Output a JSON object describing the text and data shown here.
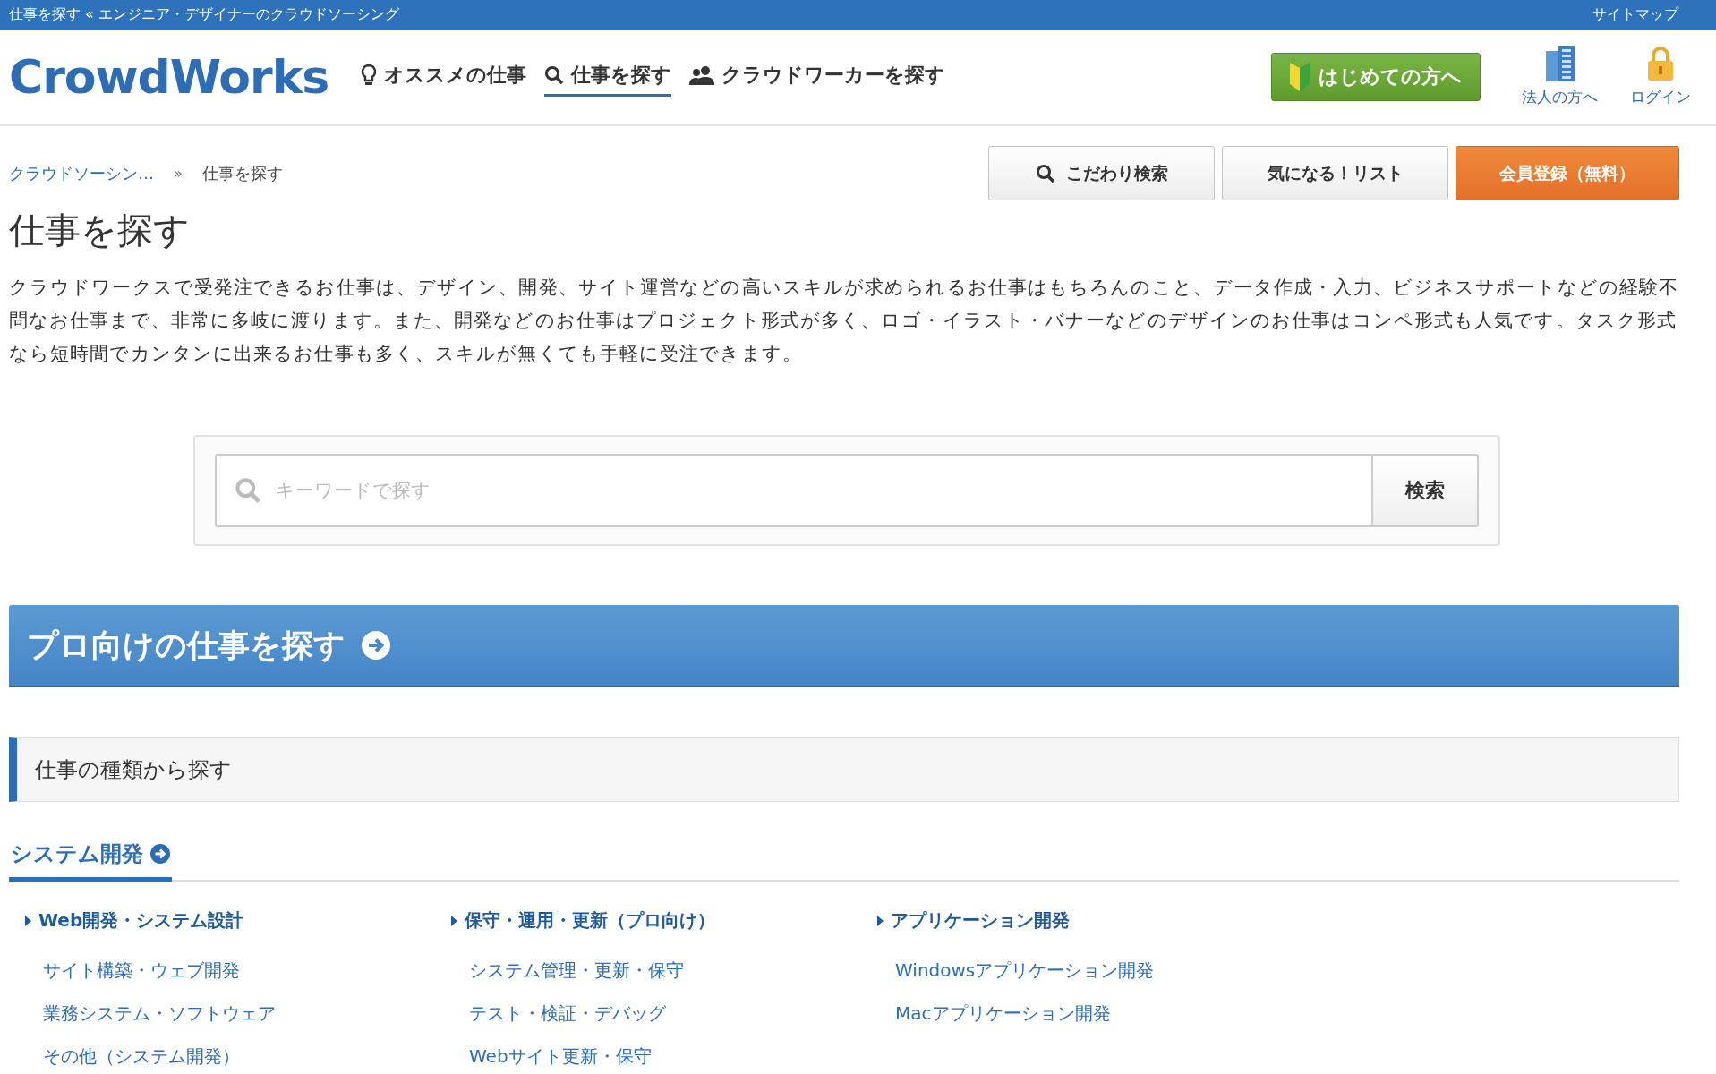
{
  "top_bar": {
    "title": "仕事を探す « エンジニア・デザイナーのクラウドソーシング",
    "sitemap": "サイトマップ"
  },
  "header": {
    "logo": "CrowdWorks",
    "nav": [
      {
        "label": "オススメの仕事",
        "kind": "bulb",
        "selected": false
      },
      {
        "label": "仕事を探す",
        "kind": "search",
        "selected": true
      },
      {
        "label": "クラウドワーカーを探す",
        "kind": "people",
        "selected": false
      }
    ],
    "beginner_button": "はじめての方へ",
    "links": [
      {
        "label": "法人の方へ",
        "kind": "building"
      },
      {
        "label": "ログイン",
        "kind": "lock"
      }
    ]
  },
  "breadcrumb": [
    {
      "label": "クラウドソーシン…",
      "kind": "link"
    },
    {
      "label": "仕事を探す",
      "kind": "current"
    }
  ],
  "breadcrumb_separator": "»",
  "actions": [
    {
      "label": "こだわり検索",
      "kind": "search"
    },
    {
      "label": "気になる！リスト",
      "kind": "plain"
    },
    {
      "label": "会員登録（無料）",
      "kind": "primary"
    }
  ],
  "page_title": "仕事を探す",
  "description": "クラウドワークスで受発注できるお仕事は、デザイン、開発、サイト運営などの高いスキルが求められるお仕事はもちろんのこと、データ作成・入力、ビジネスサポートなどの経験不問なお仕事まで、非常に多岐に渡ります。また、開発などのお仕事はプロジェクト形式が多く、ロゴ・イラスト・バナーなどのデザインのお仕事はコンペ形式も人気です。タスク形式なら短時間でカンタンに出来るお仕事も多く、スキルが無くても手軽に受注できます。",
  "search": {
    "placeholder": "キーワードで探す",
    "button": "検索"
  },
  "pro_banner": "プロ向けの仕事を探す",
  "section_title": "仕事の種類から探す",
  "category": {
    "title": "システム開発",
    "columns": [
      {
        "heading": "Web開発・システム設計",
        "links": [
          "サイト構築・ウェブ開発",
          "業務システム・ソフトウェア",
          "その他（システム開発）"
        ]
      },
      {
        "heading": "保守・運用・更新（プロ向け）",
        "links": [
          "システム管理・更新・保守",
          "テスト・検証・デバッグ",
          "Webサイト更新・保守"
        ]
      },
      {
        "heading": "アプリケーション開発",
        "links": [
          "Windowsアプリケーション開発",
          "Macアプリケーション開発"
        ]
      }
    ]
  }
}
